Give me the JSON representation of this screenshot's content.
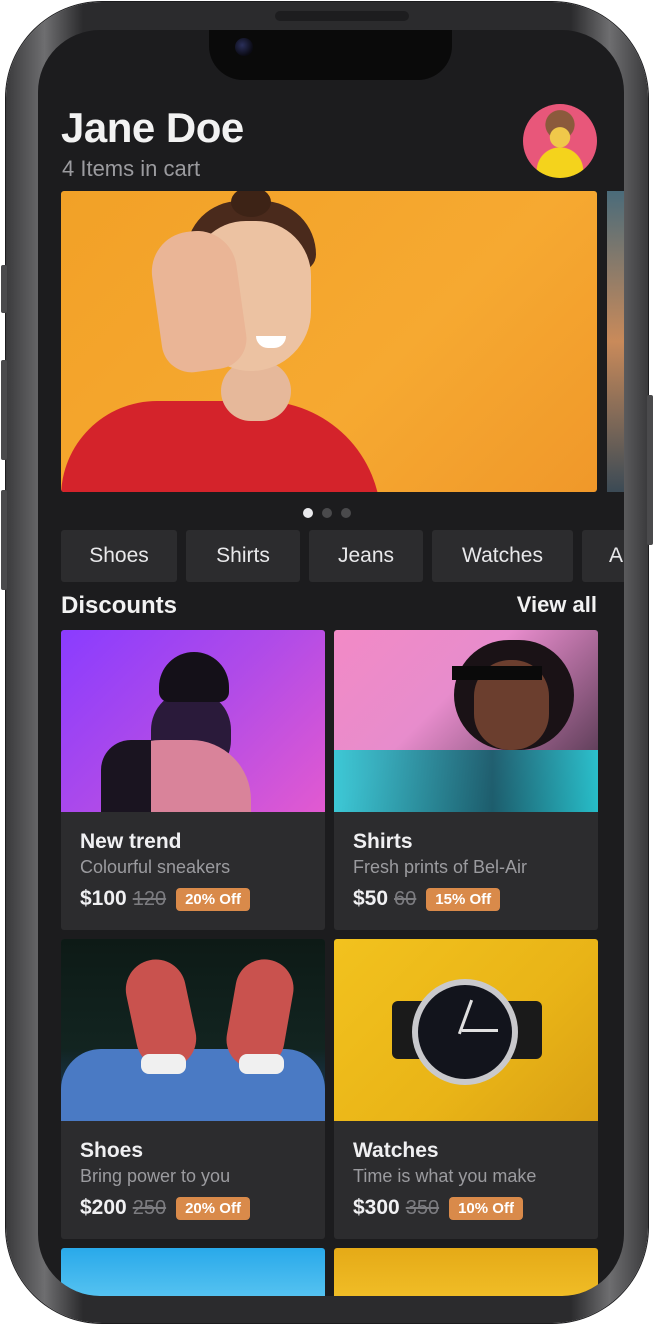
{
  "header": {
    "user_name": "Jane Doe",
    "cart_text": "4 Items in cart"
  },
  "carousel": {
    "slide_count": 3,
    "active_index": 0
  },
  "categories": [
    "Shoes",
    "Shirts",
    "Jeans",
    "Watches",
    "A"
  ],
  "discounts": {
    "title": "Discounts",
    "view_all": "View all",
    "cards": [
      {
        "title": "New trend",
        "subtitle": "Colourful sneakers",
        "price": "$100",
        "old_price": "120",
        "badge": "20% Off",
        "image": "person-in-cap-purple-light"
      },
      {
        "title": "Shirts",
        "subtitle": "Fresh prints of Bel-Air",
        "price": "$50",
        "old_price": "60",
        "badge": "15% Off",
        "image": "woman-pixel-sunglasses-neon"
      },
      {
        "title": "Shoes",
        "subtitle": "Bring power to you",
        "price": "$200",
        "old_price": "250",
        "badge": "20% Off",
        "image": "red-sneakers-jeans"
      },
      {
        "title": "Watches",
        "subtitle": "Time is what you make",
        "price": "$300",
        "old_price": "350",
        "badge": "10% Off",
        "image": "wristwatch-on-yellow"
      }
    ]
  },
  "colors": {
    "background": "#1c1c1e",
    "card": "#2c2c2e",
    "badge": "#d98a4a",
    "hero": "#f2a127"
  }
}
